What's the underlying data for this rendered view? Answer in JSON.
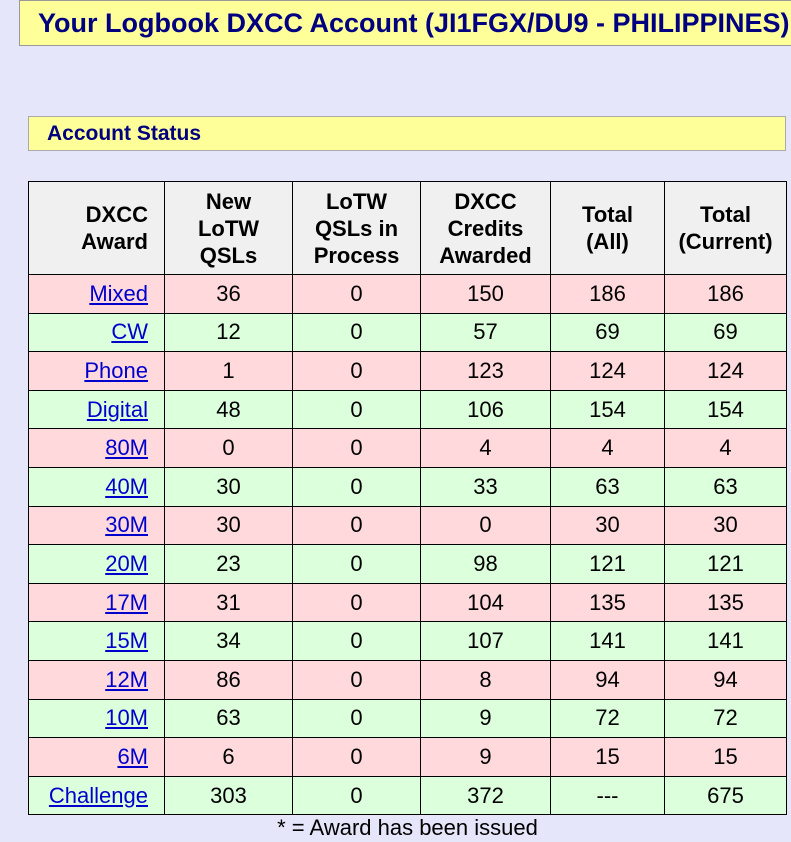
{
  "page": {
    "title": "Your Logbook DXCC Account (JI1FGX/DU9 - PHILIPPINES)",
    "section_title": "Account Status",
    "footnote": "* = Award has been issued"
  },
  "table": {
    "headers": {
      "award": [
        "DXCC",
        "Award"
      ],
      "new_lotw": [
        "New",
        "LoTW",
        "QSLs"
      ],
      "in_process": [
        "LoTW",
        "QSLs in",
        "Process"
      ],
      "credits": [
        "DXCC",
        "Credits",
        "Awarded"
      ],
      "total_all": [
        "Total",
        "(All)"
      ],
      "total_current": [
        "Total",
        "(Current)"
      ]
    },
    "rows": [
      {
        "award": "Mixed",
        "new_lotw": "36",
        "in_process": "0",
        "credits": "150",
        "total_all": "186",
        "total_current": "186"
      },
      {
        "award": "CW",
        "new_lotw": "12",
        "in_process": "0",
        "credits": "57",
        "total_all": "69",
        "total_current": "69"
      },
      {
        "award": "Phone",
        "new_lotw": "1",
        "in_process": "0",
        "credits": "123",
        "total_all": "124",
        "total_current": "124"
      },
      {
        "award": "Digital",
        "new_lotw": "48",
        "in_process": "0",
        "credits": "106",
        "total_all": "154",
        "total_current": "154"
      },
      {
        "award": "80M",
        "new_lotw": "0",
        "in_process": "0",
        "credits": "4",
        "total_all": "4",
        "total_current": "4"
      },
      {
        "award": "40M",
        "new_lotw": "30",
        "in_process": "0",
        "credits": "33",
        "total_all": "63",
        "total_current": "63"
      },
      {
        "award": "30M",
        "new_lotw": "30",
        "in_process": "0",
        "credits": "0",
        "total_all": "30",
        "total_current": "30"
      },
      {
        "award": "20M",
        "new_lotw": "23",
        "in_process": "0",
        "credits": "98",
        "total_all": "121",
        "total_current": "121"
      },
      {
        "award": "17M",
        "new_lotw": "31",
        "in_process": "0",
        "credits": "104",
        "total_all": "135",
        "total_current": "135"
      },
      {
        "award": "15M",
        "new_lotw": "34",
        "in_process": "0",
        "credits": "107",
        "total_all": "141",
        "total_current": "141"
      },
      {
        "award": "12M",
        "new_lotw": "86",
        "in_process": "0",
        "credits": "8",
        "total_all": "94",
        "total_current": "94"
      },
      {
        "award": "10M",
        "new_lotw": "63",
        "in_process": "0",
        "credits": "9",
        "total_all": "72",
        "total_current": "72"
      },
      {
        "award": "6M",
        "new_lotw": "6",
        "in_process": "0",
        "credits": "9",
        "total_all": "15",
        "total_current": "15"
      },
      {
        "award": "Challenge",
        "new_lotw": "303",
        "in_process": "0",
        "credits": "372",
        "total_all": "---",
        "total_current": "675"
      }
    ]
  },
  "colors": {
    "background": "#e6e6fa",
    "title_bar": "#ffff99",
    "title_text": "#000080",
    "row_pink": "#ffd9dc",
    "row_green": "#dcffdc",
    "header_bg": "#f0f0f0",
    "link": "#0000cc"
  }
}
